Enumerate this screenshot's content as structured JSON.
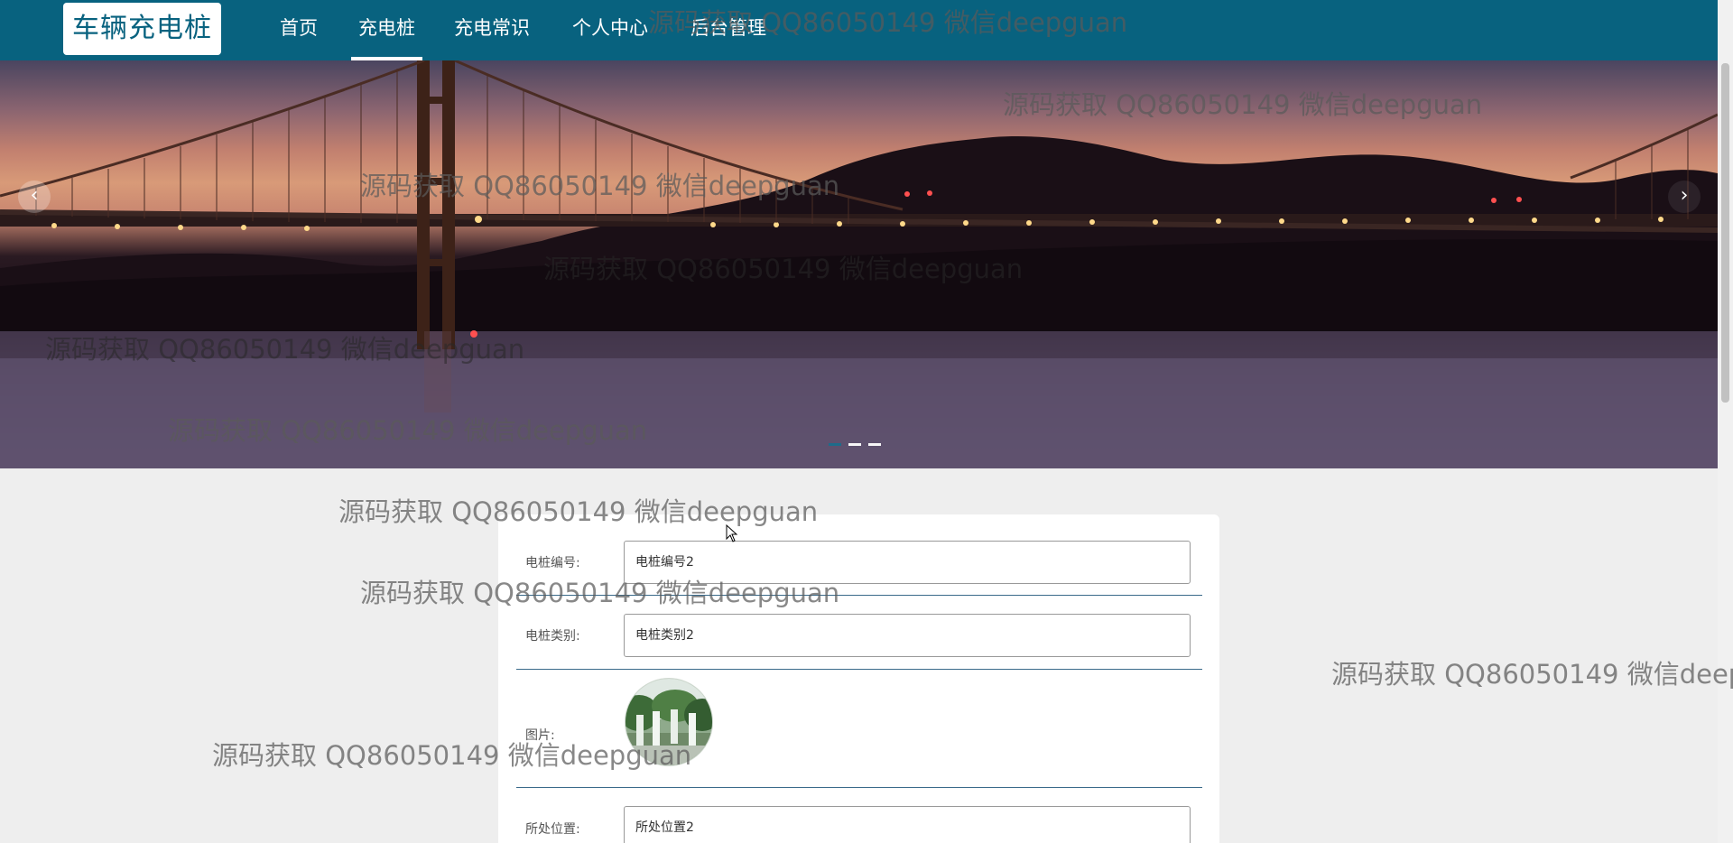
{
  "header": {
    "brand": "车辆充电桩",
    "nav": [
      {
        "label": "首页"
      },
      {
        "label": "充电桩"
      },
      {
        "label": "充电常识"
      },
      {
        "label": "个人中心"
      },
      {
        "label": "后台管理"
      }
    ],
    "active_nav": "充电桩"
  },
  "carousel": {
    "prev_icon": "chevron-left-icon",
    "next_icon": "chevron-right-icon",
    "slide_count": 3,
    "current_slide": 1
  },
  "detail": {
    "fields": [
      {
        "label": "电桩编号:",
        "value": "电桩编号2"
      },
      {
        "label": "电桩类别:",
        "value": "电桩类别2"
      },
      {
        "label": "图片:",
        "value": ""
      },
      {
        "label": "所处位置:",
        "value": "所处位置2"
      }
    ]
  },
  "watermark": {
    "text": "源码获取 QQ86050149 微信deepguan"
  },
  "colors": {
    "nav_bg": "#08627f",
    "brand_text": "#08627f",
    "page_bg": "#eeeeee",
    "divider": "#3a6a8a"
  }
}
